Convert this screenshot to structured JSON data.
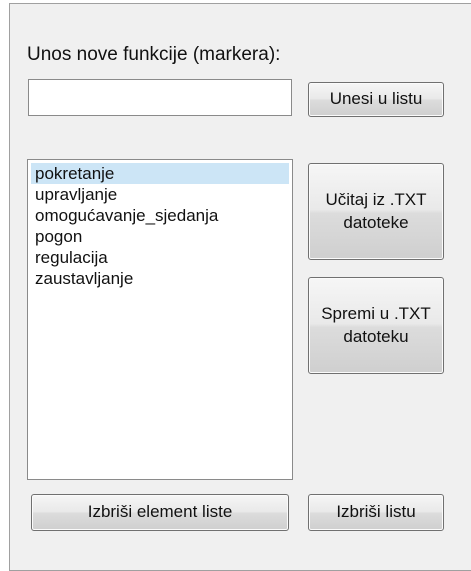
{
  "form": {
    "label": "Unos nove funkcije (markera):",
    "input_value": "",
    "add_button_label": "Unesi u listu",
    "load_button_lines": [
      "Učitaj iz .TXT",
      "datoteke"
    ],
    "save_button_lines": [
      "Spremi u .TXT",
      "datoteku"
    ],
    "delete_item_button_label": "Izbriši element liste",
    "delete_list_button_label": "Izbriši listu"
  },
  "list": {
    "selected_index": 0,
    "items": [
      "pokretanje",
      "upravljanje",
      "omogućavanje_sjedanja",
      "pogon",
      "regulacija",
      "zaustavljanje"
    ]
  }
}
